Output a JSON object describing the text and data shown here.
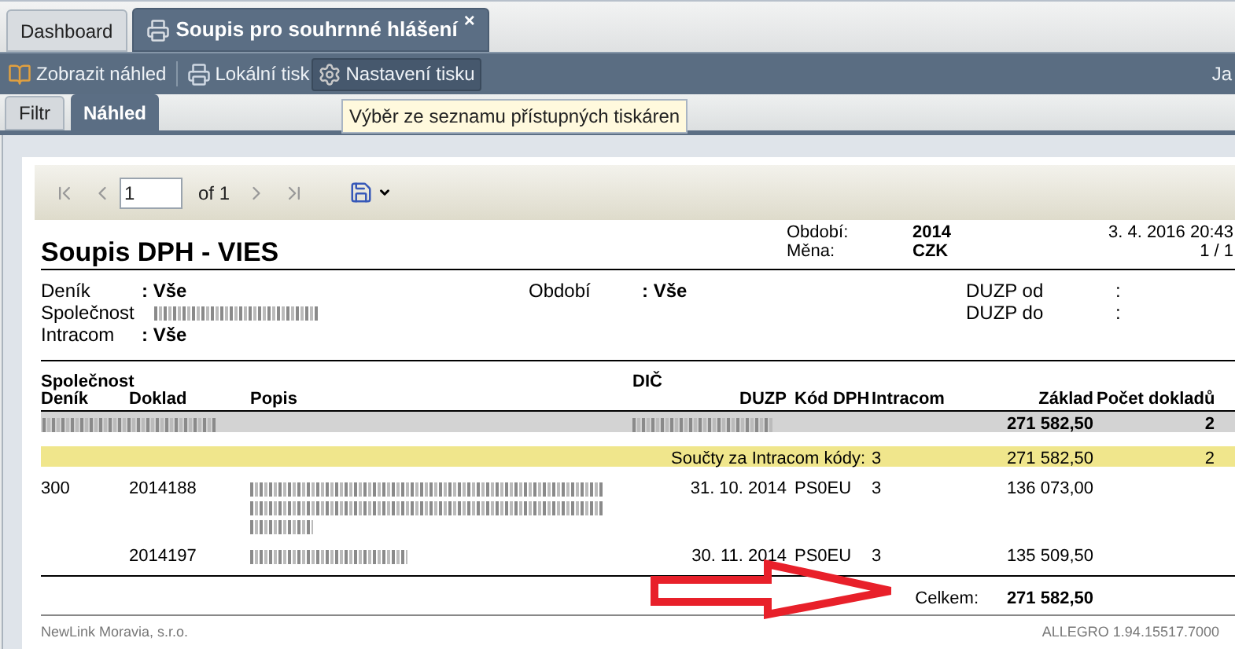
{
  "tabs": [
    {
      "label": "Dashboard",
      "selected": false
    },
    {
      "label": "Soupis pro souhrnné hlášení",
      "selected": true,
      "close_glyph": "×"
    }
  ],
  "toolbar": {
    "buttons": [
      {
        "label": "Zobrazit náhled",
        "kind": "preview",
        "highlighted": false
      },
      {
        "label": "Lokální tisk",
        "kind": "print",
        "highlighted": false
      },
      {
        "label": "Nastavení tisku",
        "kind": "settings",
        "highlighted": true
      }
    ],
    "right_text": "Ja"
  },
  "subtabs": [
    {
      "label": "Filtr",
      "selected": false
    },
    {
      "label": "Náhled",
      "selected": true
    }
  ],
  "tooltip": "Výběr ze seznamu přístupných tiskáren",
  "report_toolbar": {
    "page": "1",
    "of": "of 1"
  },
  "report": {
    "title": "Soupis DPH - VIES",
    "info": [
      {
        "label": "Období:",
        "value": "2014"
      },
      {
        "label": "Měna:",
        "value": "CZK"
      }
    ],
    "datetime": "3. 4. 2016 20:43",
    "pages": "1 / 1",
    "filters_left": [
      {
        "label": "Deník",
        "value": ": Vše",
        "kind": "text"
      },
      {
        "label": "Společnost",
        "kind": "redacted"
      },
      {
        "label": "Intracom",
        "value": ": Vše",
        "kind": "text"
      }
    ],
    "filter_middle": {
      "label": "Období",
      "value": ": Vše"
    },
    "filters_right": [
      {
        "label": "DUZP od",
        "value": ":"
      },
      {
        "label": "DUZP do",
        "value": ":"
      }
    ],
    "columns_top": [
      "Společnost",
      "DIČ"
    ],
    "columns": [
      "Deník",
      "Doklad",
      "Popis",
      "DUZP",
      "Kód DPH",
      "Intracom",
      "Základ",
      "Počet dokladů"
    ],
    "group": {
      "zaklad": "271 582,50",
      "count": "2"
    },
    "subtotal": {
      "label": "Součty za Intracom kódy:",
      "intracom": "3",
      "zaklad": "271 582,50",
      "count": "2"
    },
    "rows": [
      {
        "denik": "300",
        "doklad": "2014188",
        "popis_wrapped": true,
        "duzp": "31. 10. 2014",
        "kod": "PS0EU",
        "intracom": "3",
        "zaklad": "136 073,00"
      },
      {
        "doklad": "2014197",
        "popis_wrapped": false,
        "duzp": "30. 11. 2014",
        "kod": "PS0EU",
        "intracom": "3",
        "zaklad": "135 509,50"
      }
    ],
    "total": {
      "label": "Celkem:",
      "value": "271 582,50"
    },
    "footer_left": "NewLink Moravia, s.r.o.",
    "footer_right": "ALLEGRO 1.94.15517.7000"
  }
}
